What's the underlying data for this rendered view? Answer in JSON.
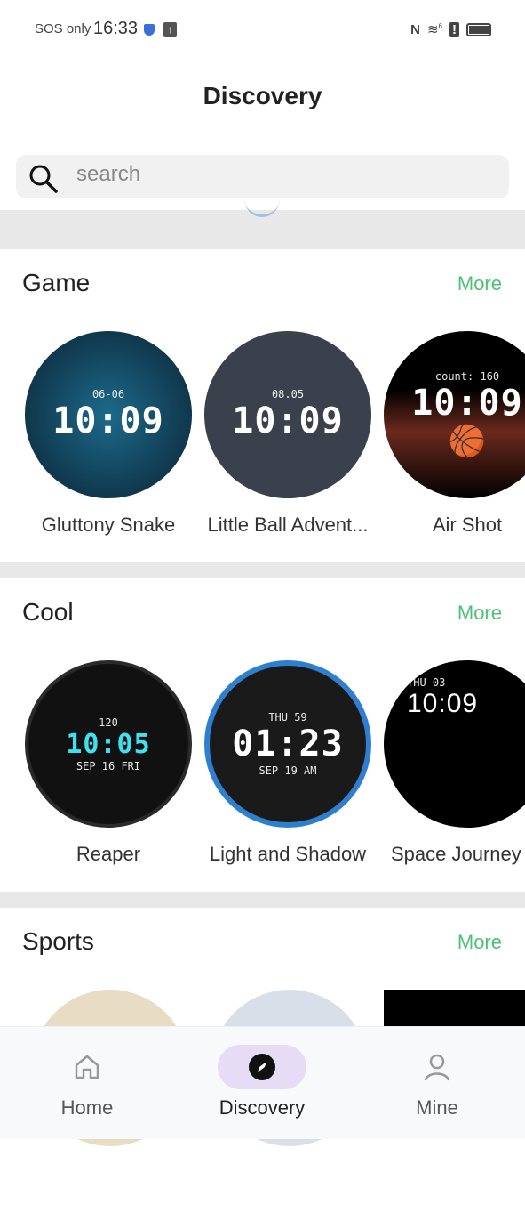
{
  "status": {
    "carrier": "SOS only",
    "time": "16:33",
    "icons": [
      "shield-icon",
      "upload-icon",
      "nfc-icon",
      "wifi-icon",
      "alert-icon",
      "battery-icon"
    ],
    "nfc": "N",
    "wifi_badge": "6"
  },
  "header": {
    "title": "Discovery"
  },
  "search": {
    "placeholder": "search"
  },
  "accent": "#4cc173",
  "sections": [
    {
      "title": "Game",
      "more": "More",
      "items": [
        {
          "name": "Gluttony Snake",
          "face": {
            "top": "06-06",
            "time": "10:09",
            "bg": "#0e3a52"
          }
        },
        {
          "name": "Little Ball Advent...",
          "face": {
            "top": "08.05",
            "time": "10:09",
            "bg": "#3a414d"
          }
        },
        {
          "name": "Air Shot",
          "face": {
            "top": "count: 160",
            "time": "10:09",
            "bg": "#000000"
          }
        }
      ]
    },
    {
      "title": "Cool",
      "more": "More",
      "items": [
        {
          "name": "Reaper",
          "face": {
            "top": "120",
            "time": "10:05",
            "bottom": "SEP 16 FRI",
            "bg": "#111111"
          }
        },
        {
          "name": "Light and Shadow",
          "face": {
            "top": "THU 59",
            "time": "01:23",
            "bottom": "SEP 19 AM",
            "bg": "#1a1a1a"
          }
        },
        {
          "name": "Space Journey",
          "face": {
            "top": "THU 03",
            "time": "10:09",
            "bg": "#000000"
          }
        }
      ]
    },
    {
      "title": "Sports",
      "more": "More",
      "items": []
    }
  ],
  "nav": {
    "items": [
      {
        "label": "Home",
        "icon": "home-icon"
      },
      {
        "label": "Discovery",
        "icon": "compass-icon",
        "active": true
      },
      {
        "label": "Mine",
        "icon": "person-icon"
      }
    ]
  }
}
